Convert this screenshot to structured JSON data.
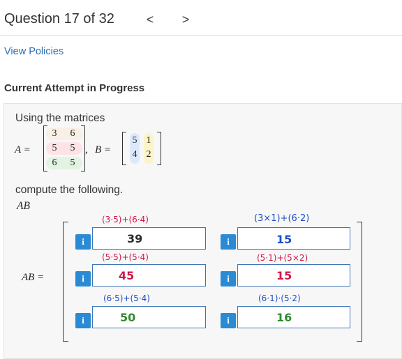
{
  "header": {
    "question_label": "Question 17 of 32",
    "prev_glyph": "<",
    "next_glyph": ">"
  },
  "links": {
    "view_policies": "View Policies"
  },
  "section": {
    "title": "Current Attempt in Progress"
  },
  "problem": {
    "intro": "Using the matrices",
    "A_label": "A =",
    "B_label": "B =",
    "comma": ",",
    "A": [
      [
        "3",
        "6"
      ],
      [
        "5",
        "5"
      ],
      [
        "6",
        "5"
      ]
    ],
    "B": [
      [
        "5",
        "1"
      ],
      [
        "4",
        "2"
      ]
    ],
    "instruction": "compute the following.",
    "expression": "AB",
    "answer_label": "AB ="
  },
  "answers": [
    {
      "formula": "(3·5)+(6·4)",
      "value": "39",
      "formula_color": "#d0164a",
      "value_color": "#2a2a2a"
    },
    {
      "formula": "(3×1)+(6·2)",
      "value": "15",
      "formula_color": "#1f4fc4",
      "value_color": "#1f4fc4"
    },
    {
      "formula": "(5·5)+(5·4)",
      "value": "45",
      "formula_color": "#d0164a",
      "value_color": "#d0164a"
    },
    {
      "formula": "(5·1)+(5×2)",
      "value": "15",
      "formula_color": "#d0164a",
      "value_color": "#d0164a"
    },
    {
      "formula": "(6·5)+(5·4)",
      "value": "50",
      "formula_color": "#1f4fc4",
      "value_color": "#2e8b2e"
    },
    {
      "formula": "(6·1)·(5·2)",
      "value": "16",
      "formula_color": "#1f4fc4",
      "value_color": "#2e8b2e"
    }
  ],
  "info_glyph": "i",
  "colors": {
    "accent": "#2a8ad4",
    "link": "#2a6fb0",
    "row1": "#fde3e6",
    "row2": "#fbe9d6",
    "row3": "#e2f3e2",
    "col1": "#dce9fb",
    "col2": "#fbf4c9"
  }
}
